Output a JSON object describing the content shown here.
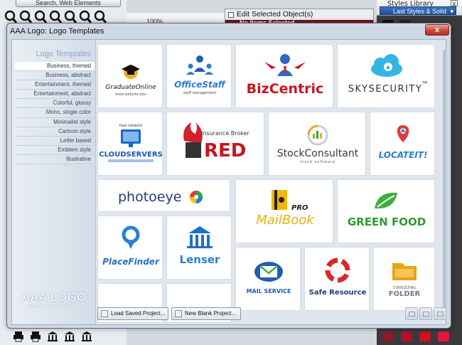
{
  "background": {
    "search_label": "Search, Web Elements",
    "zoom": "100%",
    "edit_panel": {
      "title": "Edit Selected Object(s)",
      "bar_text": "No Items Selected"
    },
    "styles_library": {
      "title": "Styles Library",
      "selected": "Last Styles & Solid",
      "close": "x"
    }
  },
  "dialog": {
    "title": "AAA Logo: Logo Templates",
    "close": "x",
    "sidebar": {
      "heading": "Logo Templates",
      "categories": [
        "Business, themed",
        "Business, abstract",
        "Entertainment, themed",
        "Entertainment, abstract",
        "Colorful, glossy",
        "Mono, single color",
        "Minimalist style",
        "Cartoon style",
        "Letter based",
        "Emblem style",
        "Illustrative"
      ],
      "brand": "AAA LOGO",
      "url": "WWW.AAA-LOGO.COM"
    },
    "footer": {
      "load": "Load Saved Project...",
      "new": "New Blank Project..."
    }
  },
  "templates": {
    "graduate": {
      "name": "GraduateOnline",
      "tag": "www.website.edu"
    },
    "officestaff": {
      "name": "OfficeStaff",
      "tag": "staff management"
    },
    "bizcentric": {
      "name": "BizCentric"
    },
    "skysecurity": {
      "name": "SKYSECURITY",
      "tm": "TM"
    },
    "cloudservers": {
      "top": "host network",
      "name": "CLOUDSERVERS"
    },
    "red": {
      "top": "Insurance Broker",
      "name": "RED"
    },
    "stock": {
      "name": "StockConsultant",
      "tag": "stock software"
    },
    "locate": {
      "name": "LOCATEIT!"
    },
    "photoeye": {
      "name": "photoeye"
    },
    "mailbook": {
      "pro": "PRO",
      "name": "MailBook"
    },
    "greenfood": {
      "name": "GREEN FOOD"
    },
    "placefinder": {
      "name": "PlaceFinder"
    },
    "lenser": {
      "name": "Lenser"
    },
    "mailservice": {
      "name": "MAIL SERVICE"
    },
    "saferesource": {
      "name": "Safe Resource"
    },
    "folder": {
      "top": "CONSULTING",
      "name": "FOLDER"
    }
  }
}
